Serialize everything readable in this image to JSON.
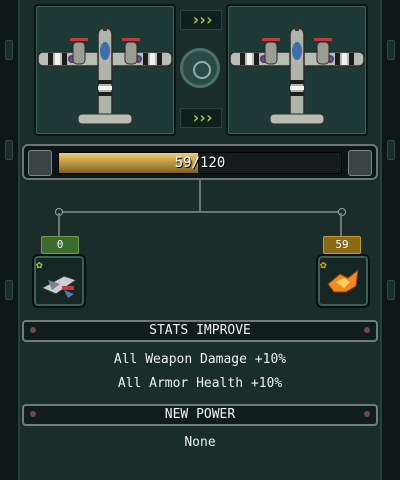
{
  "progress": {
    "text": "59/120",
    "current": 59,
    "max": 120
  },
  "rewards": {
    "left_count": "0",
    "right_count": "59"
  },
  "stats": {
    "title": "STATS IMPROVE",
    "lines": [
      "All Weapon Damage +10%",
      "All Armor Health +10%"
    ]
  },
  "power": {
    "title": "NEW POWER",
    "value": "None"
  },
  "colors": {
    "bar_fill": "#c9a24a",
    "chevrons": "#9dd14a",
    "green_badge": "#3c6b2c",
    "gold_badge": "#8a6a16"
  },
  "icons": {
    "left_card": "plane-icon",
    "right_card": "plane-icon",
    "upgrade_arrows": "chevrons-right-icon",
    "center": "gear-icon",
    "left_slot": "plane-parts-icon",
    "right_slot": "fire-crystal-icon"
  },
  "chevron_text": "›››"
}
